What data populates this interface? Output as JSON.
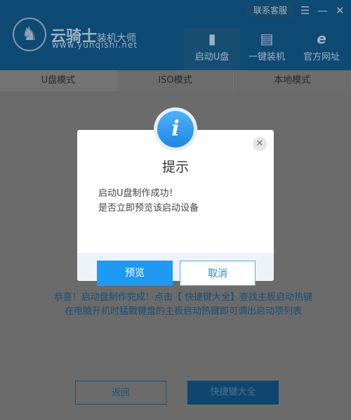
{
  "header": {
    "brand": "云骑士",
    "brand_sub": "装机大师",
    "url": "www.yunqishi.net",
    "service": "联系客服",
    "nav": [
      {
        "label": "启动U盘",
        "icon": "usb-icon"
      },
      {
        "label": "一键装机",
        "icon": "monitor-icon"
      },
      {
        "label": "官方网址",
        "icon": "ie-icon"
      }
    ]
  },
  "tabs": [
    "U盘模式",
    "ISO模式",
    "本地模式"
  ],
  "main": {
    "message1": "恭喜！启动盘制作完成！点击【 快捷键大全】查找主板启动热键",
    "message2": "在电脑开机时猛戳键盘的主板启动热键即可调出启动项列表",
    "back": "返回",
    "hotkeys": "快捷键大全"
  },
  "dialog": {
    "title": "提示",
    "line1": "启动U盘制作成功！",
    "line2": "是否立即预览该启动设备",
    "ok": "预览",
    "cancel": "取消"
  }
}
